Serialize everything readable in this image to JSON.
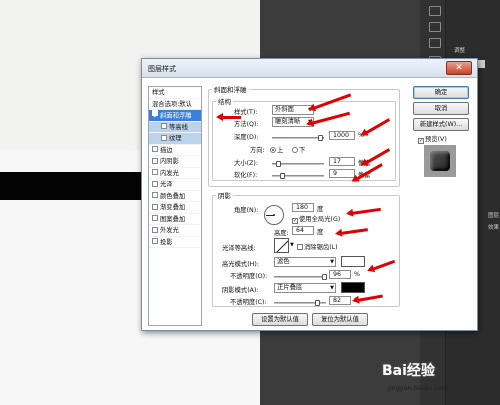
{
  "dialog": {
    "title": "图层样式",
    "close": "✕",
    "styles_list": [
      {
        "label": "样式",
        "type": "header"
      },
      {
        "label": "混合选项:默认",
        "type": "header"
      },
      {
        "label": "斜面和浮雕",
        "type": "item",
        "checked": true,
        "selected": true
      },
      {
        "label": "等高线",
        "type": "sub",
        "checked": false
      },
      {
        "label": "纹理",
        "type": "sub",
        "checked": false
      },
      {
        "label": "描边",
        "type": "item",
        "checked": false
      },
      {
        "label": "内阴影",
        "type": "item",
        "checked": false
      },
      {
        "label": "内发光",
        "type": "item",
        "checked": false
      },
      {
        "label": "光泽",
        "type": "item",
        "checked": false
      },
      {
        "label": "颜色叠加",
        "type": "item",
        "checked": false
      },
      {
        "label": "渐变叠加",
        "type": "item",
        "checked": false
      },
      {
        "label": "图案叠加",
        "type": "item",
        "checked": false
      },
      {
        "label": "外发光",
        "type": "item",
        "checked": false
      },
      {
        "label": "投影",
        "type": "item",
        "checked": false
      }
    ],
    "bevel": {
      "section_title": "斜面和浮雕",
      "structure_title": "结构",
      "style_label": "样式(T):",
      "style_value": "外斜面",
      "technique_label": "方法(Q):",
      "technique_value": "雕刻清晰",
      "depth_label": "深度(D):",
      "depth_value": "1000",
      "depth_unit": "%",
      "direction_label": "方向:",
      "direction_up": "上",
      "direction_down": "下",
      "size_label": "大小(Z):",
      "size_value": "17",
      "size_unit": "像素",
      "soften_label": "软化(F):",
      "soften_value": "9",
      "soften_unit": "像素"
    },
    "shading": {
      "title": "阴影",
      "angle_label": "角度(N):",
      "angle_value": "180",
      "angle_unit": "度",
      "global_light_label": "使用全局光(G)",
      "altitude_label": "高度:",
      "altitude_value": "64",
      "altitude_unit": "度",
      "gloss_contour_label": "光泽等高线:",
      "antialias_label": "消除锯齿(L)",
      "highlight_mode_label": "高光模式(H):",
      "highlight_mode_value": "滤色",
      "highlight_color": "#ffffff",
      "highlight_opacity_label": "不透明度(O):",
      "highlight_opacity_value": "96",
      "shadow_mode_label": "阴影模式(A):",
      "shadow_mode_value": "正片叠底",
      "shadow_color": "#000000",
      "shadow_opacity_label": "不透明度(C):",
      "shadow_opacity_value": "82",
      "percent": "%"
    },
    "buttons": {
      "make_default": "设置为默认值",
      "reset_default": "复位为默认值",
      "ok": "确定",
      "cancel": "取消",
      "new_style": "新建样式(W)...",
      "preview": "预览(V)"
    }
  },
  "workspace": {
    "panel_tab_top": "调整",
    "panel_tab_layers": "图层",
    "panel_effects": "效果"
  },
  "watermark": {
    "brand": "Bai经验",
    "url": "jingyan.baidu.com"
  }
}
